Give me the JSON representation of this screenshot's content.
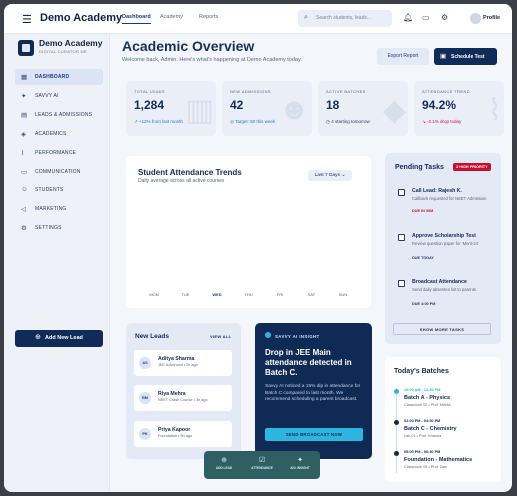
{
  "app": {
    "brand": "Demo Academy"
  },
  "topnav": {
    "tabs": [
      {
        "label": "Dashboard",
        "active": true
      },
      {
        "label": "Academy",
        "active": false
      },
      {
        "label": "Reports",
        "active": false
      }
    ],
    "search_placeholder": "Search students, leads...",
    "profile_label": "Profile",
    "icons": [
      "menu-icon",
      "search-icon",
      "bell-icon",
      "chat-icon",
      "settings-icon"
    ]
  },
  "sidebar": {
    "title": "Demo Academy",
    "subtitle": "DIGITAL CURATOR ME",
    "items": [
      {
        "label": "DASHBOARD",
        "icon": "grid-icon",
        "active": true
      },
      {
        "label": "SAVVY AI",
        "icon": "sparkle-icon",
        "active": false
      },
      {
        "label": "LEADS & ADMISSIONS",
        "icon": "leads-icon",
        "active": false
      },
      {
        "label": "ACADEMICS",
        "icon": "academics-icon",
        "active": false
      },
      {
        "label": "PERFORMANCE",
        "icon": "performance-icon",
        "active": false
      },
      {
        "label": "COMMUNICATION",
        "icon": "communication-icon",
        "active": false
      },
      {
        "label": "STUDENTS",
        "icon": "students-icon",
        "active": false
      },
      {
        "label": "MARKETING",
        "icon": "marketing-icon",
        "active": false
      },
      {
        "label": "SETTINGS",
        "icon": "settings-icon",
        "active": false
      }
    ],
    "add_lead_label": "Add New Lead"
  },
  "header": {
    "title": "Academic Overview",
    "subtitle": "Welcome back, Admin. Here's what's happening at Demo Academy today.",
    "export_label": "Export Report",
    "schedule_label": "Schedule Test"
  },
  "stats": [
    {
      "label": "TOTAL LEADS",
      "value": "1,284",
      "note": "+12% from last month",
      "note_color": "#2f6fd6"
    },
    {
      "label": "NEW ADMISSIONS",
      "value": "42",
      "note": "Target: 50 this week",
      "note_color": "#2f6fd6"
    },
    {
      "label": "ACTIVE BATCHES",
      "value": "18",
      "note": "4 starting tomorrow",
      "note_color": "#2a3a5c"
    },
    {
      "label": "ATTENDANCE TREND",
      "value": "94.2%",
      "note": "-2.1% drop today",
      "note_color": "#c8102e"
    }
  ],
  "attendance": {
    "title": "Student Attendance Trends",
    "subtitle": "Daily average across all active courses",
    "range_label": "Last 7 Days",
    "days": [
      "MON",
      "TUE",
      "WED",
      "THU",
      "FRI",
      "SAT",
      "SUN"
    ],
    "today": "WED"
  },
  "pending": {
    "title": "Pending Tasks",
    "badge": "3 HIGH PRIORITY",
    "tasks": [
      {
        "title": "Call Lead: Rajesh K.",
        "desc": "Callback requested for NEET Admission",
        "due": "DUE IN 30M",
        "due_color": "#c8102e"
      },
      {
        "title": "Approve Scholarship Test",
        "desc": "Review question paper for 'Merit-24'",
        "due": "DUE TODAY",
        "due_color": "#2a3a5c"
      },
      {
        "title": "Broadcast Attendance",
        "desc": "Send daily absentee list to parents",
        "due": "DUE 4:00 PM",
        "due_color": "#2a3a5c"
      }
    ],
    "show_more": "SHOW MORE TASKS"
  },
  "new_leads": {
    "title": "New Leads",
    "view_all": "VIEW ALL",
    "leads": [
      {
        "initials": "AS",
        "name": "Aditya Sharma",
        "meta": "JEE Advanced • 2h ago"
      },
      {
        "initials": "RM",
        "name": "Riya Mehra",
        "meta": "NEET Crash Course • 3h ago"
      },
      {
        "initials": "PK",
        "name": "Priya Kapoor",
        "meta": "Foundation • 5h ago"
      }
    ]
  },
  "insight": {
    "tag": "SAVVY AI INSIGHT",
    "headline": "Drop in JEE Main attendance detected in Batch C.",
    "body": "Savvy AI noticed a 15% dip in attendance for Batch C compared to last month. We recommend scheduling a parent broadcast.",
    "cta": "SEND BROADCAST NOW"
  },
  "batches": {
    "title": "Today's Batches",
    "items": [
      {
        "time": "10:00 AM - 12:30 PM",
        "name": "Batch A - Physics",
        "meta": "Classroom 02 • Prof. Mehta",
        "color": "#2bb5e0"
      },
      {
        "time": "02:00 PM - 04:30 PM",
        "name": "Batch C - Chemistry",
        "meta": "Lab 01 • Prof. Khanna",
        "color": "#0e2a55"
      },
      {
        "time": "05:00 PM - 06:30 PM",
        "name": "Foundation - Mathematics",
        "meta": "Classroom 05 • Prof. Das",
        "color": "#0e2a55"
      }
    ]
  },
  "floatbar": {
    "items": [
      {
        "label": "ADD LEAD",
        "icon": "plus-circle-icon"
      },
      {
        "label": "ATTENDANCE",
        "icon": "attendance-icon"
      },
      {
        "label": "AIO INSIGHT",
        "icon": "insight-icon"
      }
    ]
  }
}
